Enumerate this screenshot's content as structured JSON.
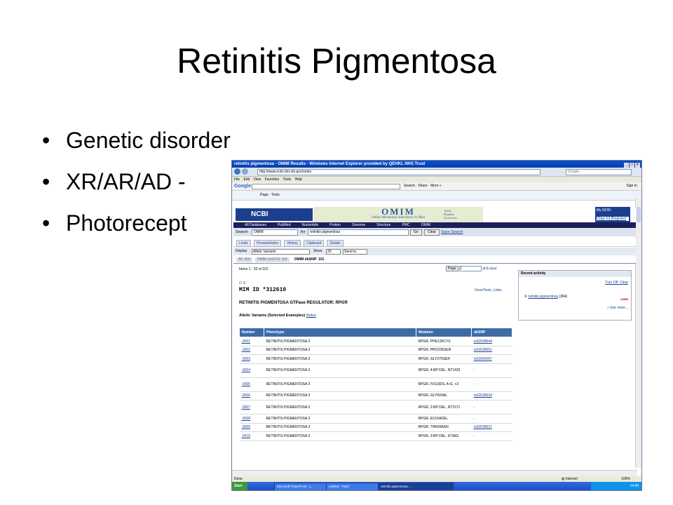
{
  "slide": {
    "title": "Retinitis Pigmentosa",
    "bullets": [
      "Genetic disorder",
      "XR/AR/AD -",
      "Photorecept"
    ]
  },
  "browser": {
    "window_title": "retinitis pigmentosa - OMIM Results - Windows Internet Explorer provided by QEHKL NHS Trust",
    "address": "http://www.ncbi.nlm.nih.gov/omim",
    "search_placeholder": "Google",
    "menu": [
      "File",
      "Edit",
      "View",
      "Favorites",
      "Tools",
      "Help"
    ],
    "google_bar": {
      "logo": "Google",
      "items": [
        "Search",
        "Share",
        "More »"
      ],
      "signin": "Sign In"
    },
    "fav_items": [
      "Page",
      "Tools"
    ],
    "status": "Done",
    "zone": "Internet",
    "zoom": "100%"
  },
  "ncbi": {
    "logo": "NCBI",
    "omim_logo": "OMIM",
    "omim_subtitle": "Online Mendelian Inheritance in Man",
    "jhu": [
      "Johns",
      "Hopkins",
      "University"
    ],
    "my_ncbi": "My NCBI",
    "sign_in": "[Sign In] [Register]",
    "nav": [
      "All Databases",
      "PubMed",
      "Nucleotide",
      "Protein",
      "Genome",
      "Structure",
      "PMC",
      "OMIM"
    ],
    "search": {
      "label": "Search",
      "database": "OMIM",
      "for_label": "for",
      "term": "retinitis pigmentosa",
      "go": "Go",
      "clear": "Clear",
      "save": "Save Search"
    },
    "tabs": [
      "Limits",
      "Preview/Index",
      "History",
      "Clipboard",
      "Details"
    ],
    "display": {
      "label": "Display",
      "value": "Allelic Variants",
      "show_label": "Show",
      "show_value": "20",
      "send_to": "Send to"
    },
    "result_tabs": [
      "All: 364",
      "OMIM UniSTS: 114",
      "OMIM dbSNP: 101"
    ],
    "items_line": "Items 1 - 20 of 101",
    "pager": {
      "button": "Page",
      "value": "1",
      "of": "of 6",
      "next": "Next"
    },
    "recent": {
      "header": "Recent activity",
      "turn_off": "Turn Off",
      "clear": "Clear",
      "item": "retinitis pigmentosa",
      "count": "(364)",
      "tag": "OMIM",
      "more": "» See more..."
    },
    "entry": {
      "checkbox_label": "1:",
      "mim_id": "MIM ID *312610",
      "links": "GeneTests, Links",
      "title": "RETINITIS PIGMENTOSA GTPase REGULATOR; RPGR",
      "allelic": "Allelic Variants (Selected Examples)",
      "notes": "Notes"
    },
    "table": {
      "headers": [
        "Number",
        "Phenotype",
        "Mutation",
        "dbSNP"
      ],
      "rows": [
        {
          "num": ".0001",
          "phen": "RETINITIS PIGMENTOSA 3",
          "mut": "RPGR, PHE130CYS",
          "snp": "rs62638644",
          "tall": false
        },
        {
          "num": ".0002",
          "phen": "RETINITIS PIGMENTOSA 3",
          "mut": "RPGR, PRO235SER",
          "snp": "rs62638651",
          "tall": false
        },
        {
          "num": ".0003",
          "phen": "RETINITIS PIGMENTOSA 3",
          "mut": "RPGR, GLY275SER",
          "snp": "rs62642057",
          "tall": false
        },
        {
          "num": ".0004",
          "phen": "RETINITIS PIGMENTOSA 3",
          "mut": "RPGR, 4-BP DEL, NT1433",
          "snp": "-",
          "tall": true
        },
        {
          "num": ".0005",
          "phen": "RETINITIS PIGMENTOSA 3",
          "mut": "RPGR, IVS10DS, A-G, +3",
          "snp": "-",
          "tall": true
        },
        {
          "num": ".0006",
          "phen": "RETINITIS PIGMENTOSA 3",
          "mut": "RPGR, GLY60VAL",
          "snp": "rs62638634",
          "tall": false
        },
        {
          "num": ".0007",
          "phen": "RETINITIS PIGMENTOSA 3",
          "mut": "RPGR, 2-BP DEL, NT1571",
          "snp": "-",
          "tall": true
        },
        {
          "num": ".0008",
          "phen": "RETINITIS PIGMENTOSA 3",
          "mut": "RPGR, EX15ADEL",
          "snp": "-",
          "tall": false
        },
        {
          "num": ".0009",
          "phen": "RETINITIS PIGMENTOSA 3",
          "mut": "RPGR, THR99ASN",
          "snp": "rs62638637",
          "tall": false
        },
        {
          "num": ".0010",
          "phen": "RETINITIS PIGMENTOSA 3",
          "mut": "RPGR, 2-BP DEL, 673AG",
          "snp": "-",
          "tall": false
        }
      ]
    }
  },
  "taskbar": {
    "start": "Start",
    "tasks": [
      "Microsoft PowerPoint - [...",
      "untitled - Paint",
      "retinitis pigmentosa -..."
    ],
    "clock": "14:48"
  }
}
